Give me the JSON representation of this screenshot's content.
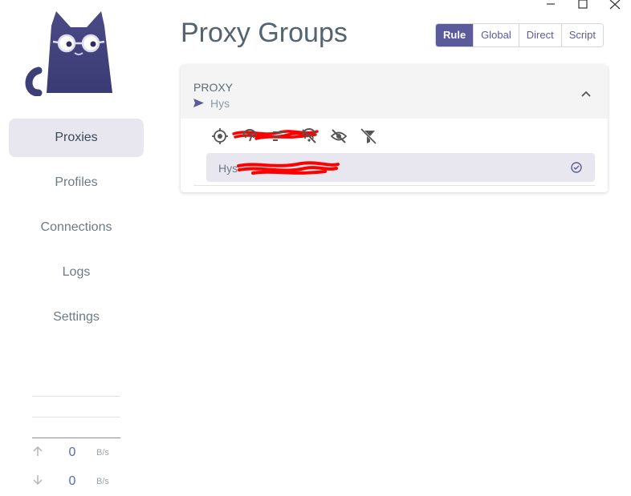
{
  "window": {
    "controls": [
      "minimize-icon",
      "maximize-icon",
      "close-icon"
    ]
  },
  "sidebar": {
    "items": [
      {
        "label": "Proxies",
        "active": true
      },
      {
        "label": "Profiles",
        "active": false
      },
      {
        "label": "Connections",
        "active": false
      },
      {
        "label": "Logs",
        "active": false
      },
      {
        "label": "Settings",
        "active": false
      }
    ],
    "traffic": {
      "up_value": "0",
      "up_unit": "B/s",
      "down_value": "0",
      "down_unit": "B/s"
    }
  },
  "main": {
    "title": "Proxy Groups",
    "modes": [
      {
        "label": "Rule",
        "active": true
      },
      {
        "label": "Global",
        "active": false
      },
      {
        "label": "Direct",
        "active": false
      },
      {
        "label": "Script",
        "active": false
      }
    ],
    "group": {
      "name": "PROXY",
      "now_prefix": "Hys",
      "tools": [
        "locate-icon",
        "delay-test-icon",
        "sort-icon",
        "filter-timeout-icon",
        "hide-icon",
        "filter-icon"
      ],
      "proxy": {
        "name_prefix": "Hys"
      }
    }
  },
  "colors": {
    "accent": "#5b5b9b",
    "active_bg": "#e8e7f0",
    "redaction": "#ff0000"
  }
}
